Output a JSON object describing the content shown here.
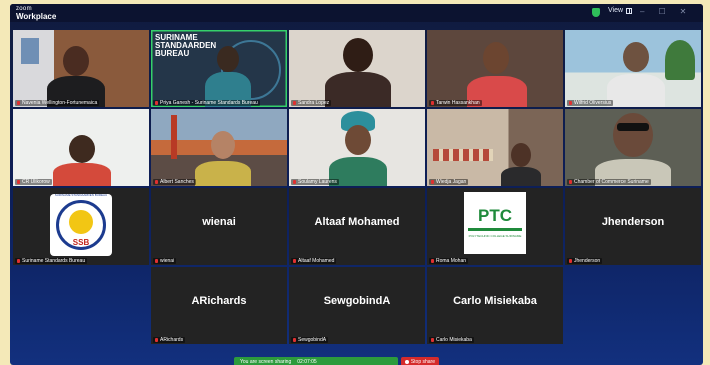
{
  "app": {
    "brand_top": "zoom",
    "brand_bottom": "Workplace",
    "view_label": "View"
  },
  "row1": [
    {
      "name": "Navenia Wellington-Fortunemaica",
      "bg": "#7a4b35"
    },
    {
      "name": "Priya Ganesh - Suriname Standards Bureau",
      "bg": "#2b3c4e",
      "banner_line1": "SURINAME",
      "banner_line2": "STANDAARDEN",
      "banner_line3": "BUREAU"
    },
    {
      "name": "Sandra Lopez",
      "bg": "#d9d2c8"
    },
    {
      "name": "Tarwin Hassankhan",
      "bg": "#6b5449"
    },
    {
      "name": "Wilfrid Oliversius",
      "bg": "#9fb9c9"
    }
  ],
  "row2": [
    {
      "name": "CR Ulikorow",
      "bg": "#e9ece9"
    },
    {
      "name": "Albert Sanches",
      "bg": "#8a6a55"
    },
    {
      "name": "Soulamy Laurens",
      "bg": "#e6e4e0"
    },
    {
      "name": "Wiedja Jagan",
      "bg": "#7c6a5c"
    },
    {
      "name": "Chamber of Commerce Suriname",
      "bg": "#5d5f55"
    }
  ],
  "row3": [
    {
      "name": "Suriname Standards Bureau",
      "logo": "ssb",
      "logo_top": "SURINAME STANDAARDEN BUREAU",
      "logo_bottom": "SSB"
    },
    {
      "name": "wienai",
      "display": "wienai"
    },
    {
      "name": "Altaaf Mohamed",
      "display": "Altaaf Mohamed"
    },
    {
      "name": "Roma Mohan",
      "logo": "ptc",
      "logo_text": "PTC",
      "logo_sub": "POLYTECHNIC COLLEGE SURINAME"
    },
    {
      "name": "Jhenderson",
      "display": "Jhenderson"
    }
  ],
  "row4": [
    {
      "name": "ARichards",
      "display": "ARichards"
    },
    {
      "name": "SewgobindA",
      "display": "SewgobindA"
    },
    {
      "name": "Carlo Misiekaba",
      "display": "Carlo Misiekaba"
    }
  ],
  "sharebar": {
    "status": "You are screen sharing",
    "timer": "02:07:05",
    "stop_label": "Stop share"
  }
}
